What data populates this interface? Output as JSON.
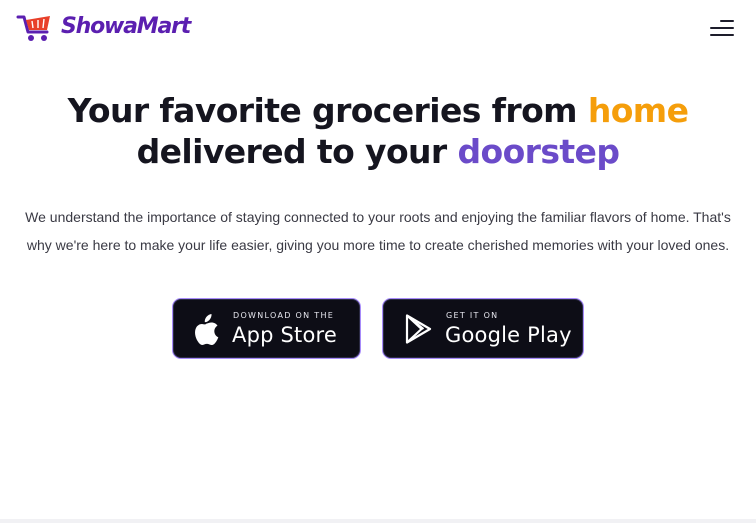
{
  "brand": {
    "name": "ShowaMart",
    "color": "#5b1fb0",
    "accent_cart": "#e8402a"
  },
  "header": {
    "menu_icon": "hamburger-menu-icon"
  },
  "hero": {
    "title_part1": "Your favorite groceries from ",
    "title_highlight1": "home",
    "title_part2": "delivered to your ",
    "title_highlight2": "doorstep",
    "highlight1_color": "#f59e0b",
    "highlight2_color": "#6b4bc9",
    "description": "We understand the importance of staying connected to your roots and enjoying the familiar flavors of home. That's why we're here to make your life easier, giving you more time to create cherished memories with your loved ones."
  },
  "store_buttons": {
    "apple": {
      "small_label": "DOWNLOAD ON THE",
      "big_label": "App Store",
      "icon": "apple-icon"
    },
    "google": {
      "small_label": "GET IT ON",
      "big_label": "Google Play",
      "icon": "google-play-icon"
    }
  }
}
